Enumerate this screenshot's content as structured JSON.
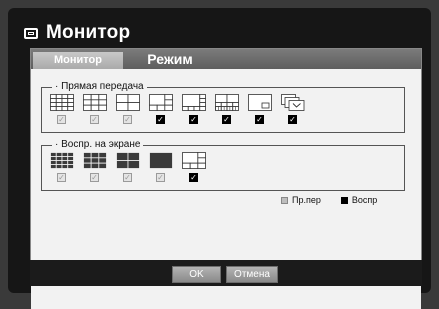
{
  "window": {
    "title": "Монитор"
  },
  "tabs": [
    {
      "label": "Монитор",
      "active": false
    },
    {
      "label": "Режим",
      "active": true
    }
  ],
  "live_group": {
    "label": "· Прямая передача",
    "layouts": [
      {
        "icon": "grid-16-icon",
        "checked": false
      },
      {
        "icon": "grid-9-icon",
        "checked": false
      },
      {
        "icon": "grid-4-icon",
        "checked": false
      },
      {
        "icon": "layout-6-icon",
        "checked": true
      },
      {
        "icon": "layout-8-icon",
        "checked": true
      },
      {
        "icon": "layout-13-icon",
        "checked": true
      },
      {
        "icon": "pip-icon",
        "checked": true
      },
      {
        "icon": "auto-sequence-icon",
        "checked": true
      }
    ]
  },
  "playback_group": {
    "label": "· Воспр. на экране",
    "layouts": [
      {
        "icon": "grid-16-icon",
        "checked": false
      },
      {
        "icon": "grid-9-icon",
        "checked": false
      },
      {
        "icon": "grid-4-icon",
        "checked": false
      },
      {
        "icon": "single-icon",
        "checked": false
      },
      {
        "icon": "layout-6-icon",
        "checked": true
      }
    ]
  },
  "legend": {
    "live_label": "Пр.пер",
    "playback_label": "Воспр"
  },
  "buttons": {
    "ok": "OK",
    "cancel": "Отмена"
  },
  "colors": {
    "panel_bg": "#f2f2f2",
    "frame_bg": "#161616",
    "tab_bar": "#6a6a6a"
  }
}
